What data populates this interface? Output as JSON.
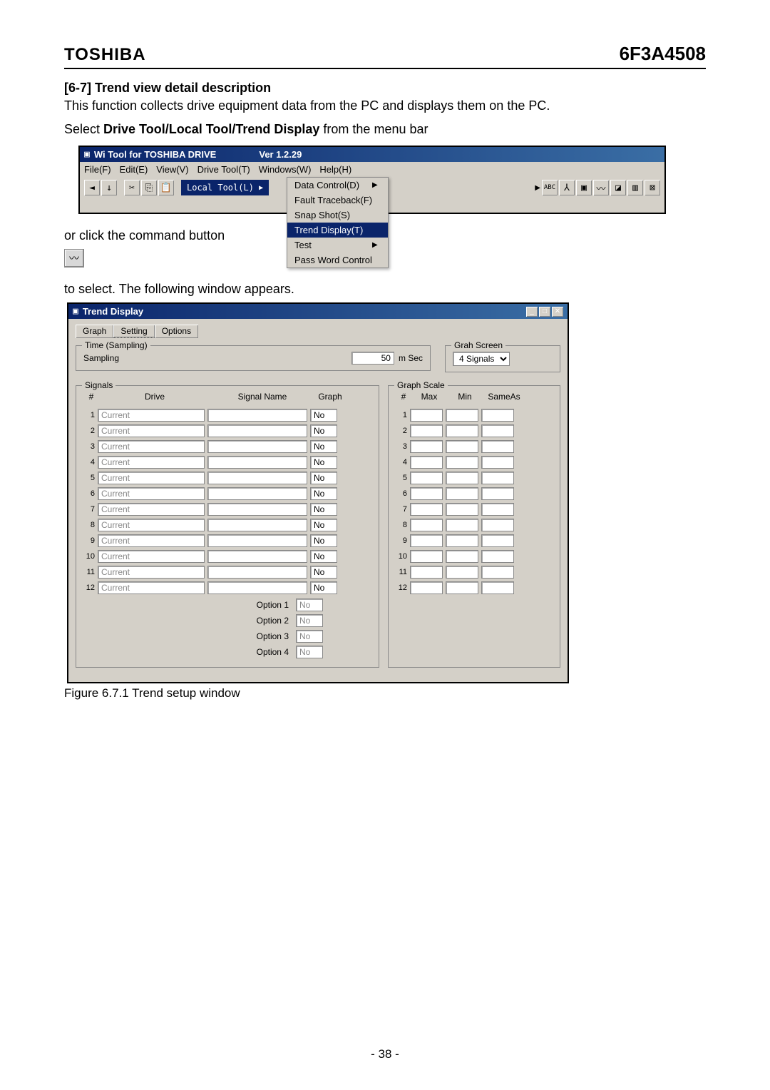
{
  "header": {
    "brand": "TOSHIBA",
    "partno": "6F3A4508"
  },
  "section": {
    "title": "[6-7] Trend view detail description",
    "desc": "This function collects drive equipment data from the PC and displays them on the PC.",
    "inst1a": "Select ",
    "inst1b": "Drive Tool/Local Tool/Trend Display",
    "inst1c": " from the menu bar",
    "inst2": "or click the command button",
    "inst3": "to select. The following window appears."
  },
  "win1": {
    "title": "Wi Tool for TOSHIBA DRIVE",
    "ver": "Ver 1.2.29",
    "menu": [
      "File(F)",
      "Edit(E)",
      "View(V)",
      "Drive Tool(T)",
      "Windows(W)",
      "Help(H)"
    ],
    "localTool": "Local Tool(L)",
    "submenu": [
      "Data Control(D)",
      "Fault Traceback(F)",
      "Snap Shot(S)",
      "Trend Display(T)",
      "Test",
      "Pass Word Control"
    ]
  },
  "caption": "Figure 6.7.1 Trend setup window",
  "trend": {
    "title": "Trend Display",
    "tabs": [
      "Graph",
      "Setting",
      "Options"
    ],
    "timeSamplingLegend": "Time (Sampling)",
    "samplingLabel": "Sampling",
    "samplingVal": "50",
    "samplingUnit": "m Sec",
    "grahLegend": "Grah Screen",
    "grahSel": "4 Signals",
    "signalsLegend": "Signals",
    "graphScaleLegend": "Graph Scale",
    "sigCols": {
      "num": "#",
      "drive": "Drive",
      "signame": "Signal Name",
      "graph": "Graph"
    },
    "scaleCols": {
      "num": "#",
      "max": "Max",
      "min": "Min",
      "sameas": "SameAs"
    },
    "rows": [
      {
        "n": "1",
        "drive": "Current",
        "sig": "",
        "graph": "No"
      },
      {
        "n": "2",
        "drive": "Current",
        "sig": "",
        "graph": "No"
      },
      {
        "n": "3",
        "drive": "Current",
        "sig": "",
        "graph": "No"
      },
      {
        "n": "4",
        "drive": "Current",
        "sig": "",
        "graph": "No"
      },
      {
        "n": "5",
        "drive": "Current",
        "sig": "",
        "graph": "No"
      },
      {
        "n": "6",
        "drive": "Current",
        "sig": "",
        "graph": "No"
      },
      {
        "n": "7",
        "drive": "Current",
        "sig": "",
        "graph": "No"
      },
      {
        "n": "8",
        "drive": "Current",
        "sig": "",
        "graph": "No"
      },
      {
        "n": "9",
        "drive": "Current",
        "sig": "",
        "graph": "No"
      },
      {
        "n": "10",
        "drive": "Current",
        "sig": "",
        "graph": "No"
      },
      {
        "n": "11",
        "drive": "Current",
        "sig": "",
        "graph": "No"
      },
      {
        "n": "12",
        "drive": "Current",
        "sig": "",
        "graph": "No"
      }
    ],
    "options": [
      {
        "label": "Option 1",
        "val": "No"
      },
      {
        "label": "Option 2",
        "val": "No"
      },
      {
        "label": "Option 3",
        "val": "No"
      },
      {
        "label": "Option 4",
        "val": "No"
      }
    ]
  },
  "footer": "- 38 -"
}
